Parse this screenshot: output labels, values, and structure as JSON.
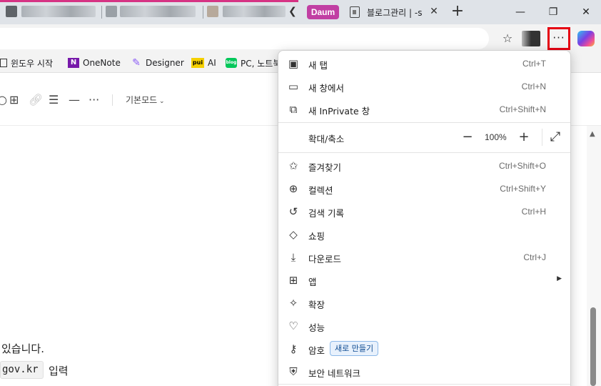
{
  "tabs": {
    "group_label": "Daum",
    "active_tab_title": "블로그관리 | -s"
  },
  "window_controls": {
    "minimize": "—",
    "restore": "❐",
    "close": "✕"
  },
  "favorites": [
    {
      "label": "윈도우 시작",
      "icon": "window-icon"
    },
    {
      "label": "OneNote",
      "icon": "onenote-icon",
      "icon_text": "N",
      "color": "#7719aa"
    },
    {
      "label": "Designer",
      "icon": "designer-icon",
      "color": "#8b5cf6"
    },
    {
      "label": "AI",
      "icon": "pui-icon",
      "icon_text": "pui",
      "color": "#f5d000"
    },
    {
      "label": "PC, 노트북",
      "icon": "blog-icon",
      "icon_text": "blog",
      "color": "#03c75a"
    }
  ],
  "editor": {
    "mode_label": "기본모드",
    "line1": "있습니다.",
    "code": "gov.kr",
    "line2": "입력"
  },
  "menu": {
    "items_top": [
      {
        "icon": "new-tab-icon",
        "label": "새 탭",
        "shortcut": "Ctrl+T"
      },
      {
        "icon": "new-window-icon",
        "label": "새 창에서",
        "shortcut": "Ctrl+N"
      },
      {
        "icon": "inprivate-icon",
        "label": "새 InPrivate 창",
        "shortcut": "Ctrl+Shift+N"
      }
    ],
    "zoom": {
      "label": "확대/축소",
      "value": "100%"
    },
    "items_bottom": [
      {
        "icon": "favorites-icon",
        "label": "즐겨찾기",
        "shortcut": "Ctrl+Shift+O"
      },
      {
        "icon": "collections-icon",
        "label": "컬렉션",
        "shortcut": "Ctrl+Shift+Y"
      },
      {
        "icon": "history-icon",
        "label": "검색 기록",
        "shortcut": "Ctrl+H"
      },
      {
        "icon": "shopping-icon",
        "label": "쇼핑",
        "shortcut": ""
      },
      {
        "icon": "download-icon",
        "label": "다운로드",
        "shortcut": "Ctrl+J"
      },
      {
        "icon": "apps-icon",
        "label": "앱",
        "shortcut": ""
      },
      {
        "icon": "extensions-icon",
        "label": "확장",
        "shortcut": ""
      },
      {
        "icon": "performance-icon",
        "label": "성능",
        "shortcut": ""
      },
      {
        "icon": "password-icon",
        "label": "암호",
        "shortcut": "",
        "badge": "새로 만들기"
      },
      {
        "icon": "secure-network-icon",
        "label": "보안 네트워크",
        "shortcut": ""
      }
    ]
  },
  "colors": {
    "highlight_box": "#e60012",
    "tab_group": "#c13fa3",
    "badge_bg": "#e8f1fc"
  }
}
